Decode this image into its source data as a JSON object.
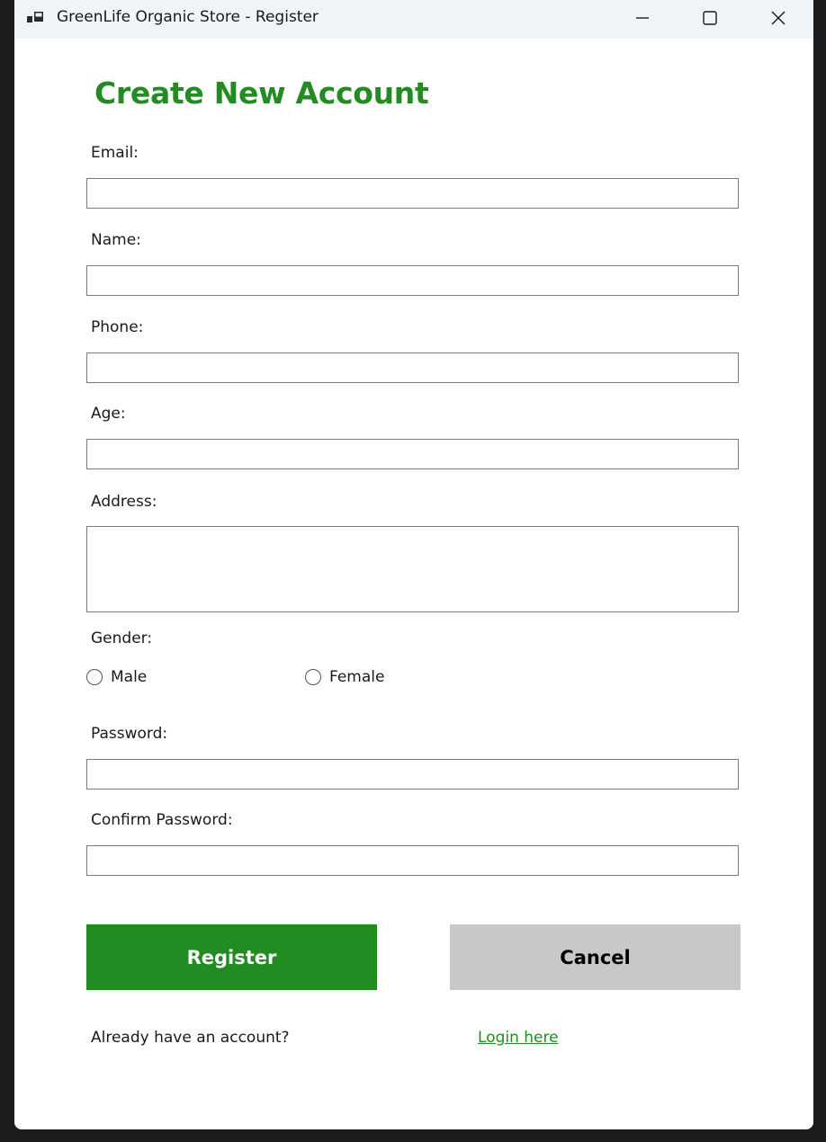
{
  "window": {
    "title": "GreenLife Organic Store - Register"
  },
  "form": {
    "heading": "Create New Account",
    "email_label": "Email:",
    "email_value": "",
    "name_label": "Name:",
    "name_value": "",
    "phone_label": "Phone:",
    "phone_value": "",
    "age_label": "Age:",
    "age_value": "",
    "address_label": "Address:",
    "address_value": "",
    "gender_label": "Gender:",
    "gender_options": [
      "Male",
      "Female"
    ],
    "password_label": "Password:",
    "password_value": "",
    "confirm_password_label": "Confirm Password:",
    "confirm_password_value": ""
  },
  "buttons": {
    "register_label": "Register",
    "cancel_label": "Cancel"
  },
  "footer": {
    "prompt": "Already have an account?",
    "login_link": "Login here"
  },
  "colors": {
    "accent": "#228b22",
    "cancel_bg": "#c8c8c8"
  },
  "icons": {
    "app": "app-window-icon",
    "minimize": "minimize-icon",
    "maximize": "maximize-icon",
    "close": "close-icon"
  }
}
